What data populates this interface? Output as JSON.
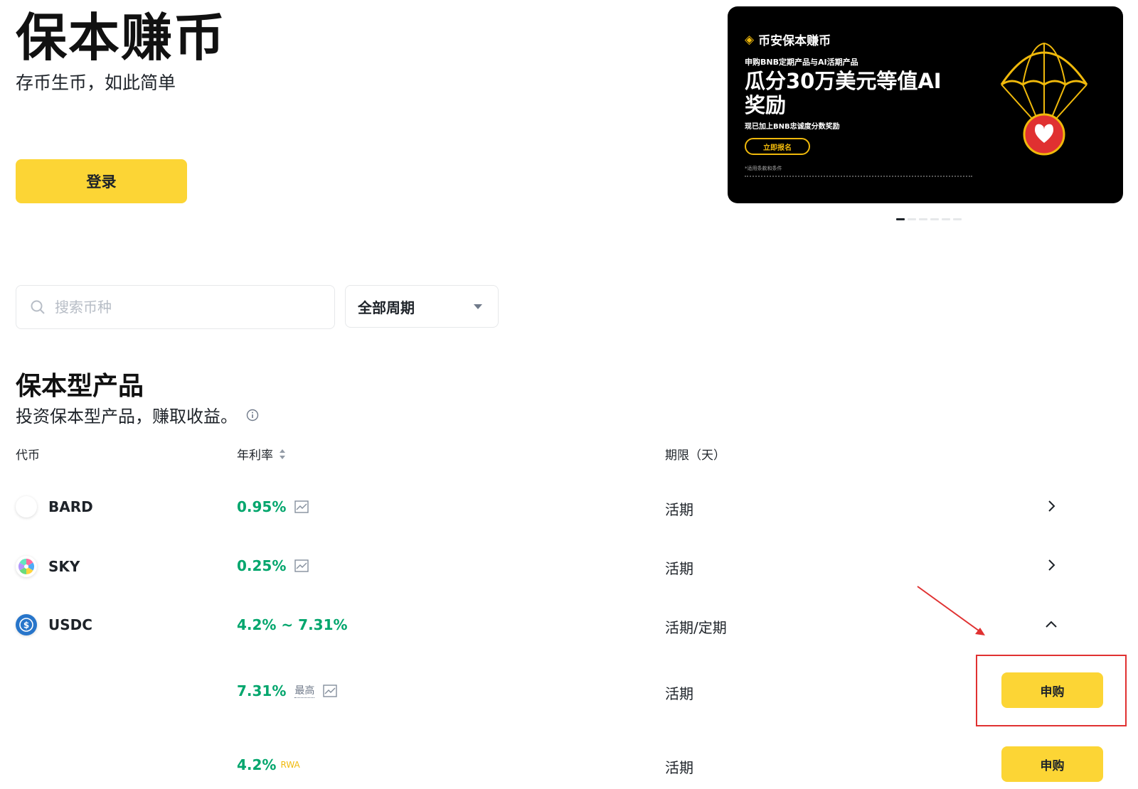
{
  "hero": {
    "title": "保本赚币",
    "subtitle": "存币生币，如此简单",
    "login_label": "登录"
  },
  "banner": {
    "brand": "币安保本赚币",
    "line1": "申购BNB定期产品与AI活期产品",
    "headline": "瓜分30万美元等值AI奖励",
    "line2": "现已加上BNB忠诚度分数奖励",
    "cta": "立即报名",
    "terms": "*适用条款和条件"
  },
  "carousel": {
    "count": 6,
    "active_index": 0
  },
  "filters": {
    "search_placeholder": "搜索币种",
    "period_value": "全部周期"
  },
  "section": {
    "title": "保本型产品",
    "subtitle": "投资保本型产品，赚取收益。"
  },
  "table": {
    "headers": {
      "coin": "代币",
      "apr": "年利率",
      "term": "期限（天）"
    },
    "rows": [
      {
        "coin": "BARD",
        "apr": "0.95%",
        "term": "活期"
      },
      {
        "coin": "SKY",
        "apr": "0.25%",
        "term": "活期"
      },
      {
        "coin": "USDC",
        "apr": "4.2% ~ 7.31%",
        "term": "活期/定期"
      }
    ],
    "subrows": [
      {
        "apr": "7.31%",
        "tag": "最高",
        "term": "活期",
        "button": "申购"
      },
      {
        "apr": "4.2%",
        "tag": "RWA",
        "term": "活期",
        "button": "申购"
      }
    ]
  },
  "colors": {
    "accent": "#fcd535",
    "positive": "#03a66d",
    "annotation": "#e03131"
  }
}
